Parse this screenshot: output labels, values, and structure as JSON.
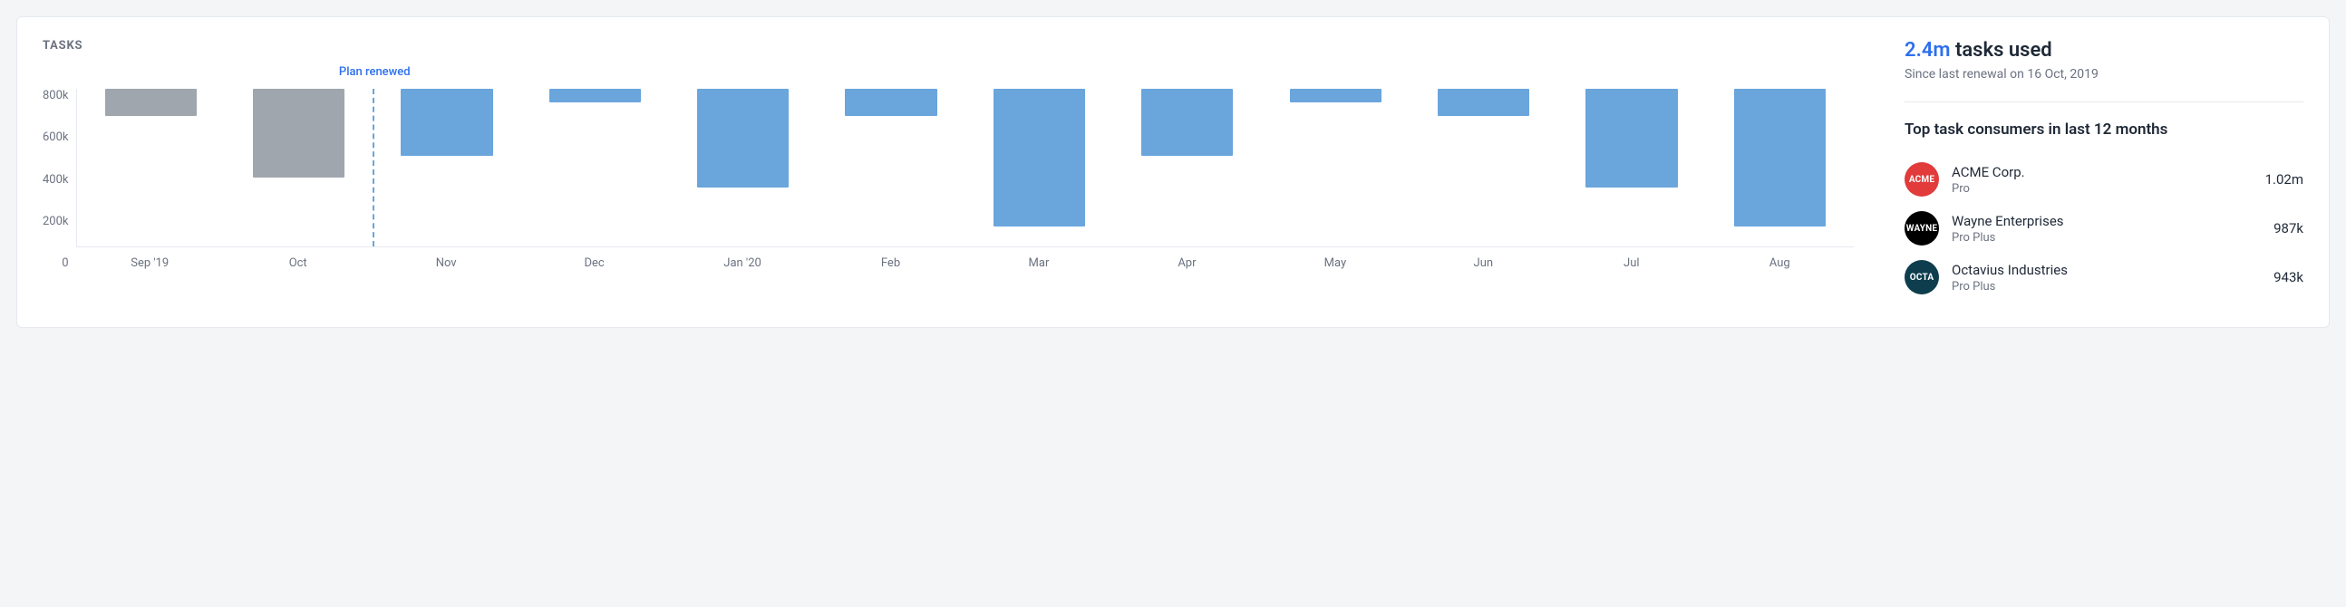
{
  "title": "TASKS",
  "chart_data": {
    "type": "bar",
    "title": "TASKS",
    "xlabel": "",
    "ylabel": "",
    "ylim": [
      0,
      800000
    ],
    "y_ticks": [
      "0",
      "200k",
      "400k",
      "600k",
      "800k"
    ],
    "categories": [
      "Sep '19",
      "Oct",
      "Nov",
      "Dec",
      "Jan '20",
      "Feb",
      "Mar",
      "Apr",
      "May",
      "Jun",
      "Jul",
      "Aug"
    ],
    "values": [
      140000,
      450000,
      340000,
      70000,
      500000,
      140000,
      700000,
      340000,
      70000,
      140000,
      500000,
      700000
    ],
    "pre_renewal_months": 2,
    "annotation": {
      "after_index": 1,
      "label": "Plan renewed"
    }
  },
  "summary": {
    "value": "2.4m",
    "label": "tasks used",
    "sub": "Since last renewal on 16 Oct, 2019"
  },
  "consumers_heading": "Top task consumers in last 12 months",
  "consumers": [
    {
      "name": "ACME Corp.",
      "plan": "Pro",
      "value": "1.02m",
      "avatar_color": "#e23b3b",
      "avatar_text": "ACME"
    },
    {
      "name": "Wayne Enterprises",
      "plan": "Pro Plus",
      "value": "987k",
      "avatar_color": "#000000",
      "avatar_text": "Wayne"
    },
    {
      "name": "Octavius Industries",
      "plan": "Pro Plus",
      "value": "943k",
      "avatar_color": "#0e3d4d",
      "avatar_text": "Octa"
    }
  ]
}
